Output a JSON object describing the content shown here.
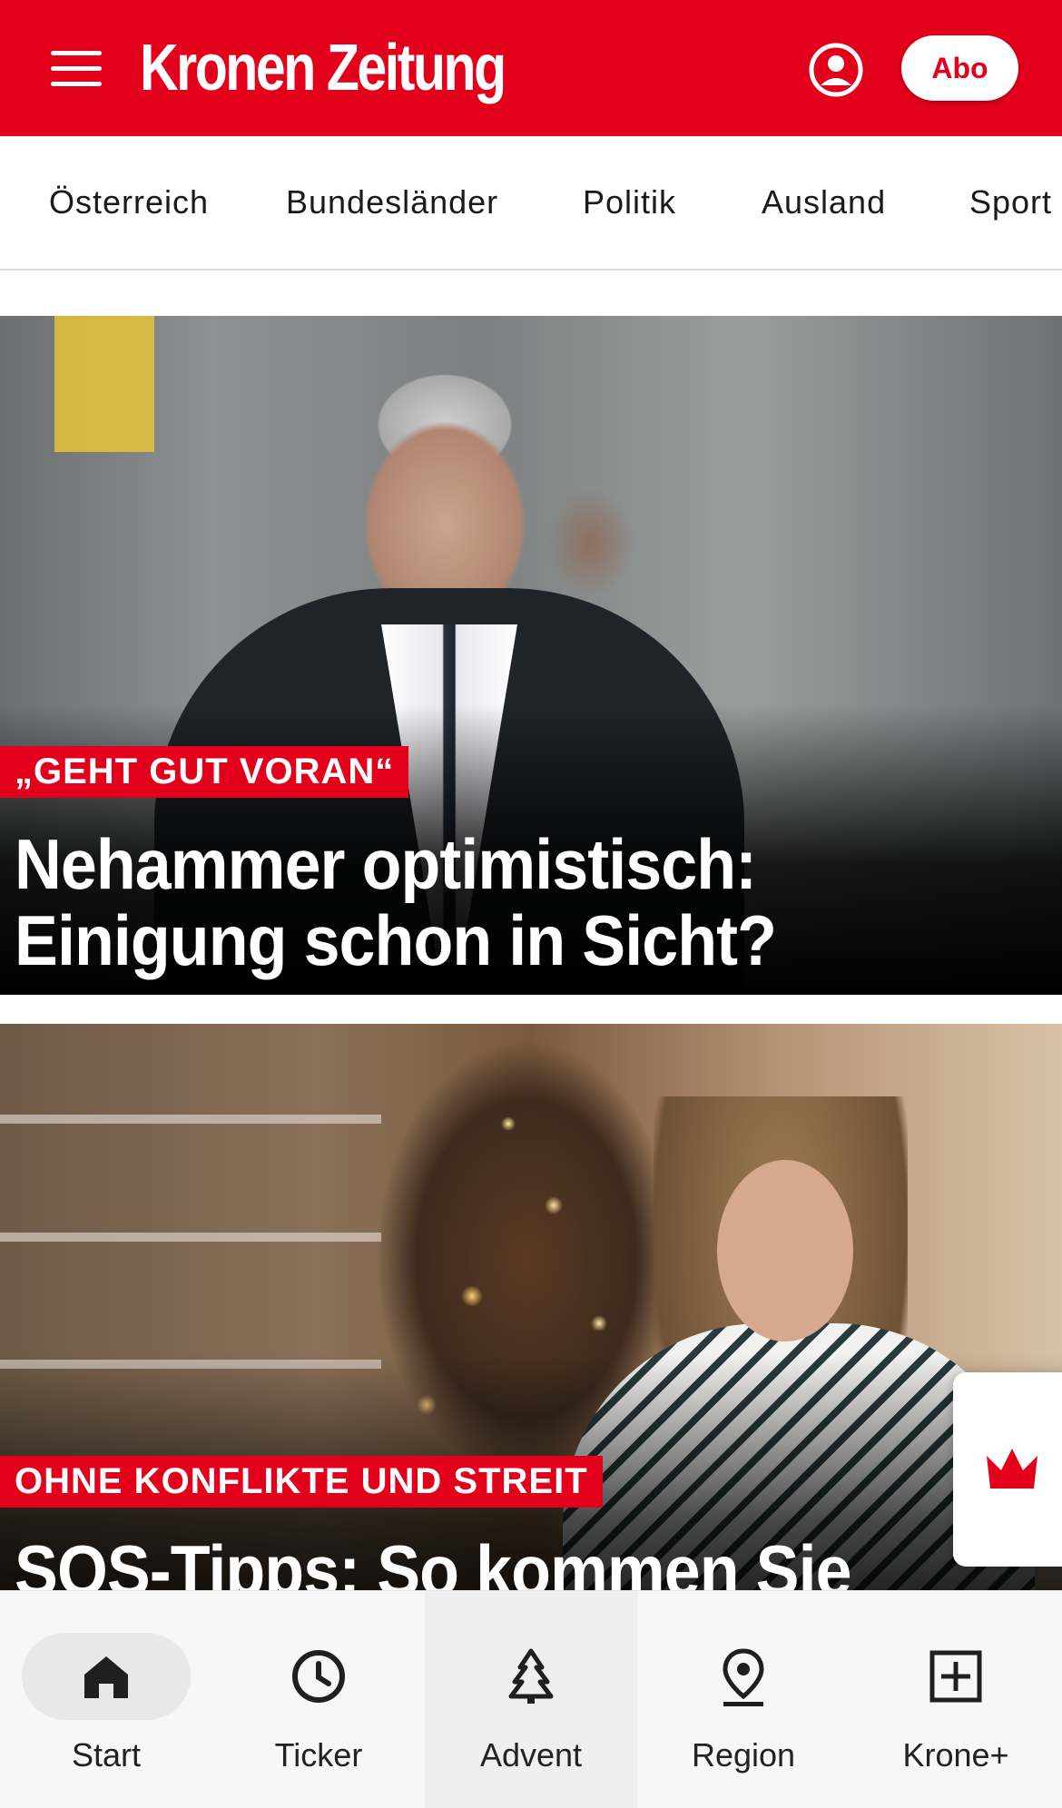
{
  "header": {
    "logo_text": "Kronen Zeitung",
    "abo_label": "Abo",
    "brand_color": "#e2001a"
  },
  "categories": [
    "Österreich",
    "Bundesländer",
    "Politik",
    "Ausland",
    "Sport"
  ],
  "articles": [
    {
      "kicker": "„GEHT GUT VORAN“",
      "headline_line1": "Nehammer optimistisch:",
      "headline_line2": "Einigung schon in Sicht?"
    },
    {
      "kicker": "OHNE KONFLIKTE UND STREIT",
      "headline_line1": "SOS-Tipps: So kommen Sie"
    }
  ],
  "bottom_nav": {
    "items": [
      {
        "label": "Start",
        "icon": "home-icon",
        "selected": true
      },
      {
        "label": "Ticker",
        "icon": "clock-icon"
      },
      {
        "label": "Advent",
        "icon": "tree-icon"
      },
      {
        "label": "Region",
        "icon": "location-pin-icon"
      },
      {
        "label": "Krone+",
        "icon": "plus-box-icon"
      }
    ]
  },
  "icons": {
    "menu": "menu-icon",
    "account": "account-icon",
    "crown": "crown-icon"
  }
}
